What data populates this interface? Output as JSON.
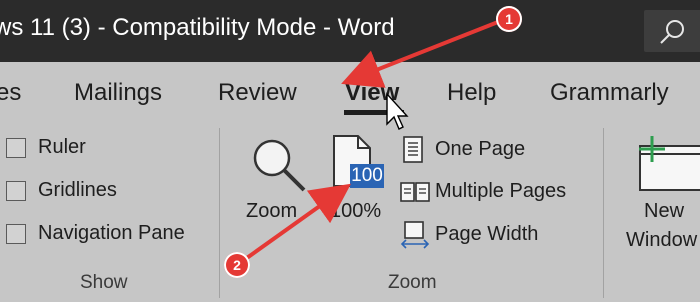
{
  "window": {
    "title": "ws 11 (3)  -  Compatibility Mode  -  Word"
  },
  "tabs": [
    {
      "label": "es"
    },
    {
      "label": "Mailings"
    },
    {
      "label": "Review"
    },
    {
      "label": "View",
      "active": true
    },
    {
      "label": "Help"
    },
    {
      "label": "Grammarly"
    }
  ],
  "show_group": {
    "ruler": {
      "label": "Ruler",
      "checked": false
    },
    "gridlines": {
      "label": "Gridlines",
      "checked": false
    },
    "navigation_pane": {
      "label": "Navigation Pane",
      "checked": false
    },
    "group_label": "Show"
  },
  "zoom_group": {
    "zoom_button": {
      "label": "Zoom",
      "icon": "magnifier-icon"
    },
    "zoom100_button": {
      "label": "100%",
      "badge": "100",
      "icon": "page-icon"
    },
    "one_page": {
      "label": "One Page",
      "icon": "one-page-icon"
    },
    "multiple_pages": {
      "label": "Multiple Pages",
      "icon": "multiple-pages-icon"
    },
    "page_width": {
      "label": "Page Width",
      "icon": "page-width-icon"
    },
    "group_label": "Zoom"
  },
  "window_group": {
    "new_window": {
      "label_line1": "New",
      "label_line2": "Window",
      "icon": "new-window-icon"
    }
  },
  "annotations": {
    "callout_1": "1",
    "callout_2": "2"
  },
  "colors": {
    "titlebar": "#2b2b2b",
    "ribbon": "#c6c6c6",
    "accent_blue": "#2a64b4",
    "annotation_red": "#e53935",
    "new_window_plus": "#2e9e4f"
  }
}
